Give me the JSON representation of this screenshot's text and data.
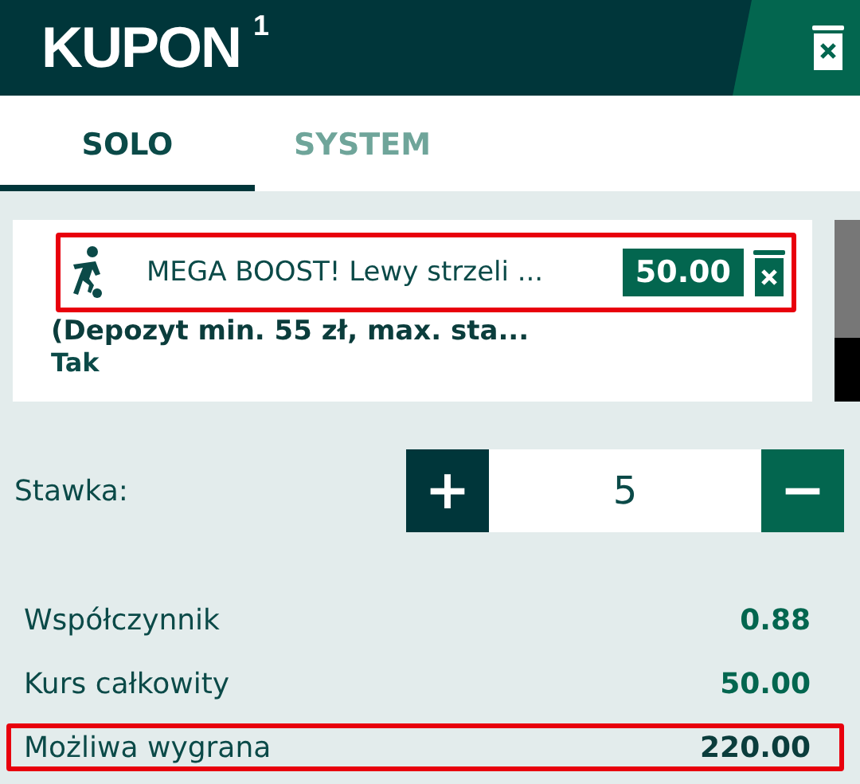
{
  "header": {
    "title": "KUPON",
    "count": "1"
  },
  "tabs": [
    {
      "label": "SOLO",
      "selected": true
    },
    {
      "label": "SYSTEM",
      "selected": false
    }
  ],
  "bet": {
    "name": "MEGA BOOST! Lewy strzeli ...",
    "odds": "50.00",
    "highlighted": true,
    "details": "(Depozyt min. 55 zł, max. sta...",
    "pick": "Tak"
  },
  "stake": {
    "label": "Stawka:",
    "plus": "+",
    "value": "5",
    "minus": "−"
  },
  "summary": [
    {
      "label": "Współczynnik",
      "value": "0.88",
      "highlighted": false
    },
    {
      "label": "Kurs całkowity",
      "value": "50.00",
      "highlighted": false
    },
    {
      "label": "Możliwa wygrana",
      "value": "220.00",
      "highlighted": true
    }
  ]
}
